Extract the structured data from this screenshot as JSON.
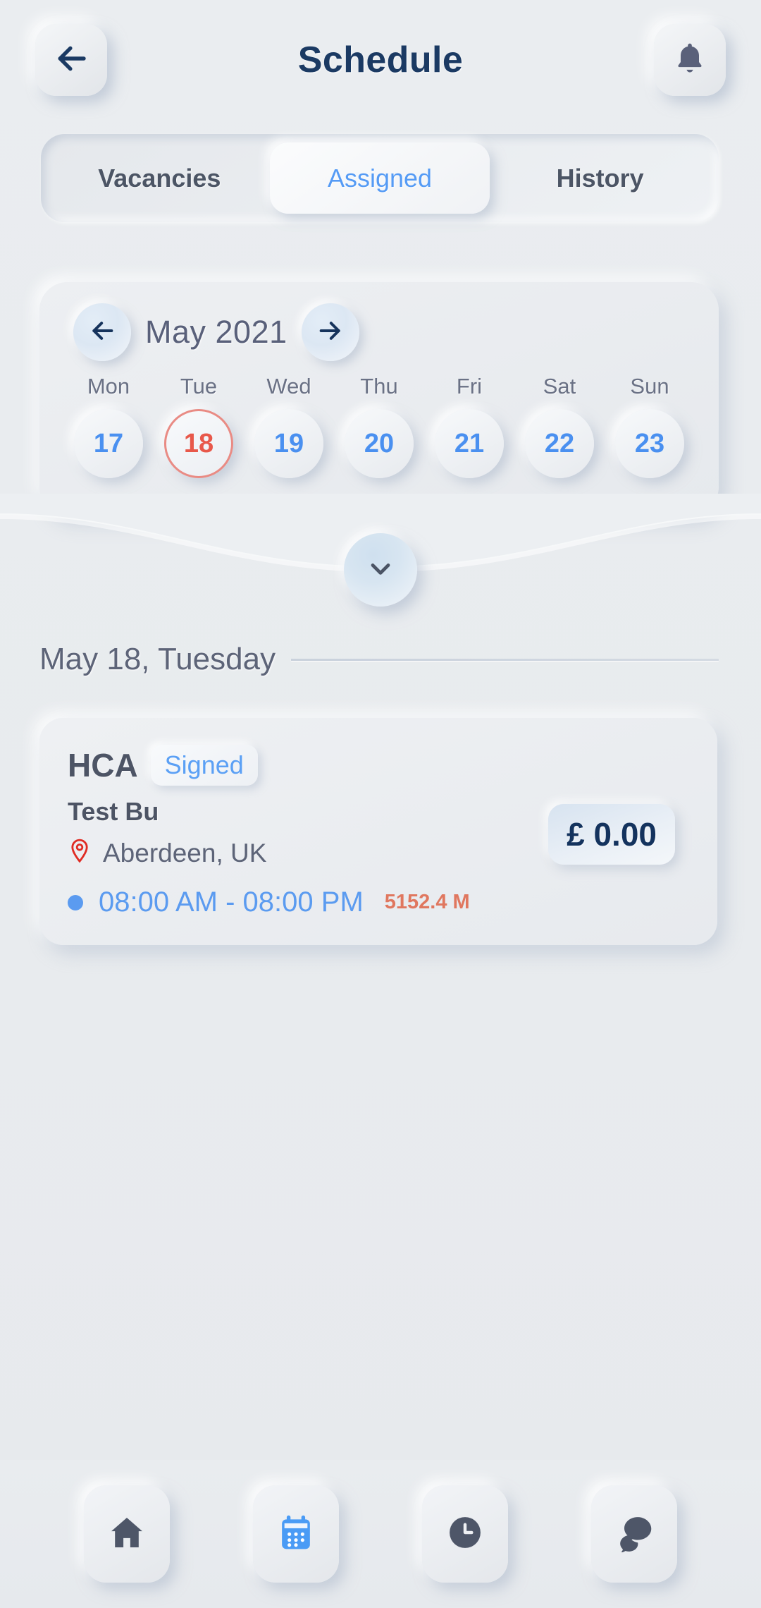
{
  "header": {
    "title": "Schedule",
    "back_icon": "arrow-left-icon",
    "bell_icon": "bell-icon"
  },
  "tabs": [
    {
      "label": "Vacancies",
      "active": false
    },
    {
      "label": "Assigned",
      "active": true
    },
    {
      "label": "History",
      "active": false
    }
  ],
  "calendar": {
    "month_label": "May 2021",
    "prev_icon": "arrow-left-icon",
    "next_icon": "arrow-right-icon",
    "weekdays": [
      "Mon",
      "Tue",
      "Wed",
      "Thu",
      "Fri",
      "Sat",
      "Sun"
    ],
    "dates": [
      {
        "day": "17",
        "selected": false
      },
      {
        "day": "18",
        "selected": true
      },
      {
        "day": "19",
        "selected": false
      },
      {
        "day": "20",
        "selected": false
      },
      {
        "day": "21",
        "selected": false
      },
      {
        "day": "22",
        "selected": false
      },
      {
        "day": "23",
        "selected": false
      }
    ],
    "expand_icon": "chevron-down-icon"
  },
  "section": {
    "date_heading": "May 18, Tuesday"
  },
  "job": {
    "role": "HCA",
    "status": "Signed",
    "organisation": "Test Bu",
    "location": "Aberdeen, UK",
    "location_icon": "map-pin-icon",
    "time_range": "08:00 AM - 08:00 PM",
    "distance": "5152.4 M",
    "price": "£ 0.00"
  },
  "bottom_nav": [
    {
      "icon": "home-icon",
      "active": false
    },
    {
      "icon": "calendar-icon",
      "active": true
    },
    {
      "icon": "clock-icon",
      "active": false
    },
    {
      "icon": "chat-icon",
      "active": false
    }
  ],
  "colors": {
    "background": "#e9ecef",
    "title_navy": "#1b3a63",
    "accent_blue": "#5b9bf0",
    "selected_red": "#e8584a",
    "distance_coral": "#e0775f",
    "text_slate": "#5d6478"
  }
}
